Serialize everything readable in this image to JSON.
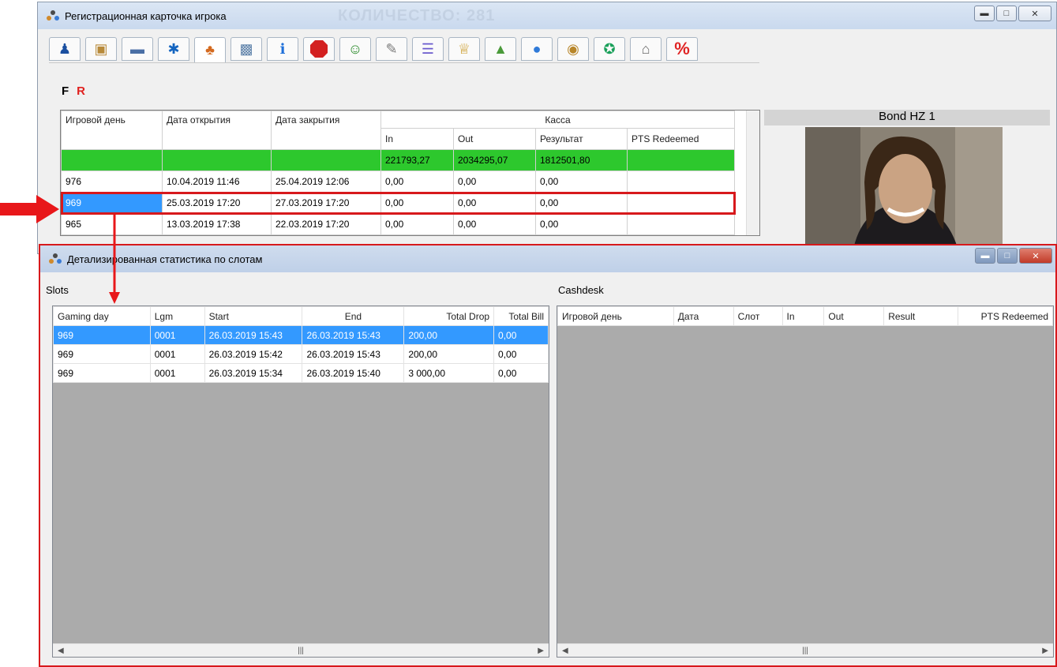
{
  "back_window": {
    "title": "Регистрационная карточка игрока",
    "blurred_title": "КОЛИЧЕСТВО: 281",
    "toolbar_icons": [
      "player-icon",
      "card-icon",
      "payment-card-icon",
      "bluetooth-icon",
      "cards-icon",
      "photo-icon",
      "info-icon",
      "stop-icon",
      "people-icon",
      "pen-icon",
      "document-icon",
      "trophy-icon",
      "chart-icon",
      "chat-icon",
      "coins-icon",
      "coin-icon",
      "bank-icon",
      "percent-icon"
    ],
    "filter_f": "F",
    "filter_r": "R",
    "grid": {
      "headers": {
        "gaming_day": "Игровой день",
        "open_date": "Дата открытия",
        "close_date": "Дата закрытия",
        "kassa": "Касса",
        "in": "In",
        "out": "Out",
        "result": "Результат",
        "pts": "PTS Redeemed"
      },
      "totals": {
        "in": "221793,27",
        "out": "2034295,07",
        "result": "1812501,80"
      },
      "rows": [
        {
          "day": "976",
          "open": "10.04.2019 11:46",
          "close": "25.04.2019 12:06",
          "in": "0,00",
          "out": "0,00",
          "result": "0,00",
          "pts": ""
        },
        {
          "day": "969",
          "open": "25.03.2019 17:20",
          "close": "27.03.2019 17:20",
          "in": "0,00",
          "out": "0,00",
          "result": "0,00",
          "pts": ""
        },
        {
          "day": "965",
          "open": "13.03.2019 17:38",
          "close": "22.03.2019 17:20",
          "in": "0,00",
          "out": "0,00",
          "result": "0,00",
          "pts": ""
        }
      ]
    },
    "player_name": "Bond HZ 1"
  },
  "front_window": {
    "title": "Детализированная статистика по слотам",
    "slots_label": "Slots",
    "cashdesk_label": "Cashdesk",
    "slots_headers": [
      "Gaming day",
      "Lgm",
      "Start",
      "End",
      "Total Drop",
      "Total Bill"
    ],
    "slots_rows": [
      [
        "969",
        "0001",
        "26.03.2019 15:43",
        "26.03.2019 15:43",
        "200,00",
        "0,00"
      ],
      [
        "969",
        "0001",
        "26.03.2019 15:42",
        "26.03.2019 15:43",
        "200,00",
        "0,00"
      ],
      [
        "969",
        "0001",
        "26.03.2019 15:34",
        "26.03.2019 15:40",
        "3 000,00",
        "0,00"
      ]
    ],
    "cashdesk_headers": [
      "Игровой день",
      "Дата",
      "Слот",
      "In",
      "Out",
      "Result",
      "PTS Redeemed"
    ]
  },
  "colors": {
    "highlight_red": "#d7191c",
    "selection_blue": "#3399ff",
    "totals_green": "#2dc82d"
  }
}
